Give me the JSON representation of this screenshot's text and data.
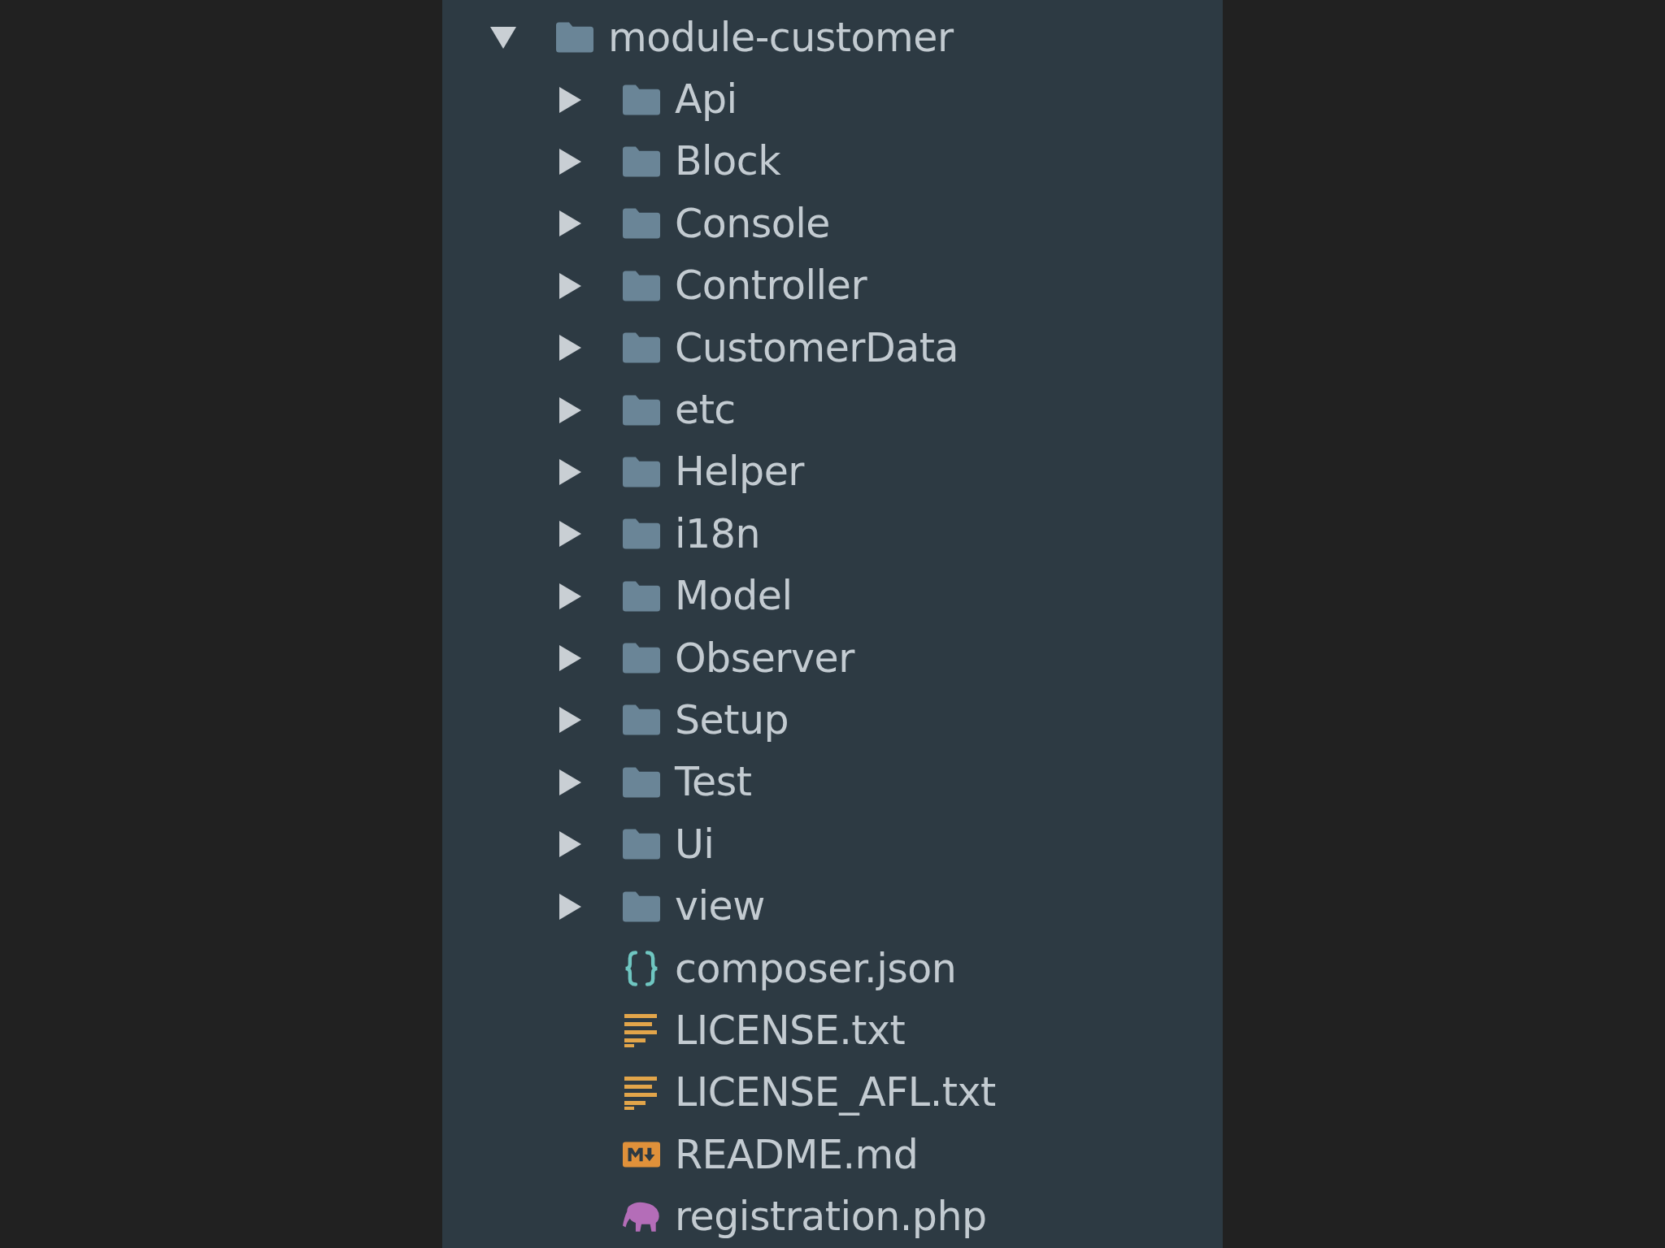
{
  "tree": [
    {
      "label": "module-customer",
      "kind": "folder",
      "expanded": true,
      "children": [
        {
          "label": "Api",
          "kind": "folder",
          "expanded": false
        },
        {
          "label": "Block",
          "kind": "folder",
          "expanded": false
        },
        {
          "label": "Console",
          "kind": "folder",
          "expanded": false
        },
        {
          "label": "Controller",
          "kind": "folder",
          "expanded": false
        },
        {
          "label": "CustomerData",
          "kind": "folder",
          "expanded": false
        },
        {
          "label": "etc",
          "kind": "folder",
          "expanded": false
        },
        {
          "label": "Helper",
          "kind": "folder",
          "expanded": false
        },
        {
          "label": "i18n",
          "kind": "folder",
          "expanded": false
        },
        {
          "label": "Model",
          "kind": "folder",
          "expanded": false
        },
        {
          "label": "Observer",
          "kind": "folder",
          "expanded": false
        },
        {
          "label": "Setup",
          "kind": "folder",
          "expanded": false
        },
        {
          "label": "Test",
          "kind": "folder",
          "expanded": false
        },
        {
          "label": "Ui",
          "kind": "folder",
          "expanded": false
        },
        {
          "label": "view",
          "kind": "folder",
          "expanded": false
        },
        {
          "label": "composer.json",
          "kind": "json"
        },
        {
          "label": "LICENSE.txt",
          "kind": "text"
        },
        {
          "label": "LICENSE_AFL.txt",
          "kind": "text"
        },
        {
          "label": "README.md",
          "kind": "markdown"
        },
        {
          "label": "registration.php",
          "kind": "php"
        }
      ]
    }
  ]
}
